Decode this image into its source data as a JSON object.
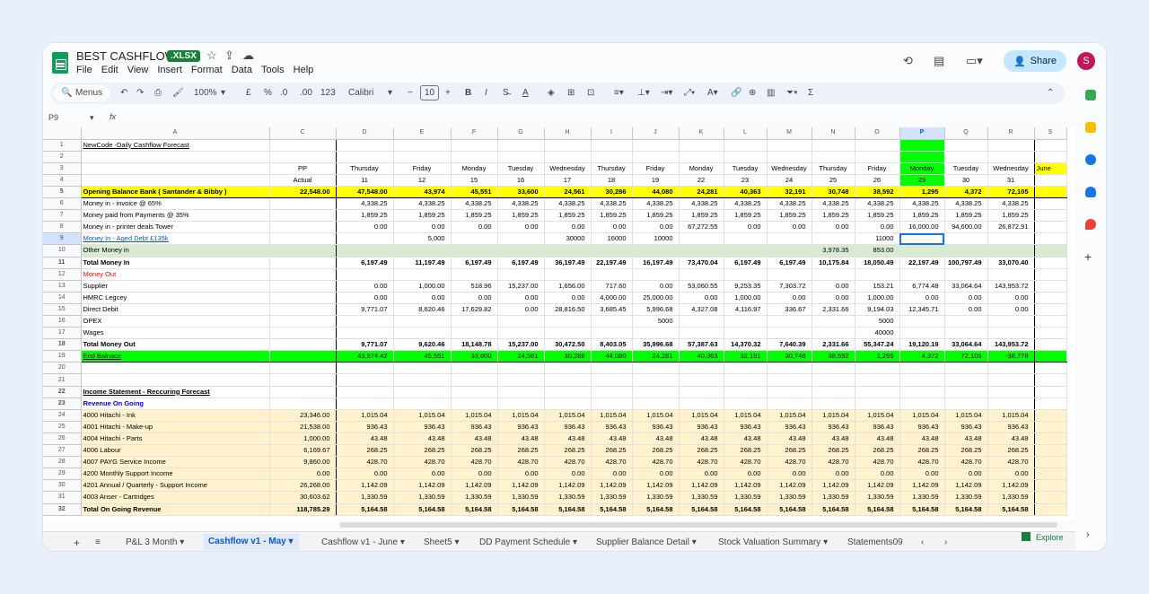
{
  "app": {
    "title": "BEST CASHFLOW",
    "badge": ".XLSX",
    "menus": [
      "File",
      "Edit",
      "View",
      "Insert",
      "Format",
      "Data",
      "Tools",
      "Help"
    ],
    "share": "Share",
    "avatar": "S"
  },
  "toolbar": {
    "menus": "Menus",
    "zoom": "100%",
    "currency": "£",
    "percent": "%",
    "dec_less": ".0",
    "dec_more": ".00",
    "num": "123",
    "font": "Calibri",
    "font_size": "10"
  },
  "formula": {
    "cell": "P9",
    "fx": "fx"
  },
  "columns": [
    "A",
    "C",
    "D",
    "E",
    "F",
    "G",
    "H",
    "I",
    "J",
    "K",
    "L",
    "M",
    "N",
    "O",
    "P",
    "Q",
    "R",
    "S"
  ],
  "rows": [
    {
      "n": "1",
      "cls": "",
      "cells": [
        "NewCode -Daily Cashflow Forecast",
        "",
        "",
        "",
        "",
        "",
        "",
        "",
        "",
        "",
        "",
        "",
        "",
        "",
        "",
        "",
        "",
        ""
      ],
      "u": 1
    },
    {
      "n": "2",
      "cls": "",
      "cells": [
        "",
        "",
        "",
        "",
        "",
        "",
        "",
        "",
        "",
        "",
        "",
        "",
        "",
        "",
        "",
        "",
        "",
        ""
      ]
    },
    {
      "n": "3",
      "cls": "",
      "cells": [
        "",
        "PP",
        "Thursday",
        "Friday",
        "Monday",
        "Tuesday",
        "Wednesday",
        "Thursday",
        "Friday",
        "Monday",
        "Tuesday",
        "Wednesday",
        "Thursday",
        "Friday",
        "Monday",
        "Tuesday",
        "Wednesday",
        "June"
      ],
      "center": 1
    },
    {
      "n": "4",
      "cls": "",
      "cells": [
        "",
        "Actual",
        "11",
        "12",
        "15",
        "16",
        "17",
        "18",
        "19",
        "22",
        "23",
        "24",
        "25",
        "26",
        "29",
        "30",
        "31",
        ""
      ],
      "center": 1
    },
    {
      "n": "5",
      "cls": "ylw bold",
      "cells": [
        "Opening Balance Bank ( Santander & Bibby )",
        "22,548.00",
        "47,548.00",
        "43,974",
        "45,551",
        "33,600",
        "24,561",
        "30,286",
        "44,080",
        "24,281",
        "40,363",
        "32,191",
        "30,748",
        "38,592",
        "1,295",
        "4,372",
        "72,105",
        ""
      ]
    },
    {
      "n": "6",
      "cls": "",
      "cells": [
        "Money in - invoice @ 65%",
        "",
        "4,338.25",
        "4,338.25",
        "4,338.25",
        "4,338.25",
        "4,338.25",
        "4,338.25",
        "4,338.25",
        "4,338.25",
        "4,338.25",
        "4,338.25",
        "4,338.25",
        "4,338.25",
        "4,338.25",
        "4,338.25",
        "4,338.25",
        ""
      ]
    },
    {
      "n": "7",
      "cls": "",
      "cells": [
        "Money paid from Payments @ 35%",
        "",
        "1,859.25",
        "1,859.25",
        "1,859.25",
        "1,859.25",
        "1,859.25",
        "1,859.25",
        "1,859.25",
        "1,859.25",
        "1,859.25",
        "1,859.25",
        "1,859.25",
        "1,859.25",
        "1,859.25",
        "1,859.25",
        "1,859.25",
        ""
      ]
    },
    {
      "n": "8",
      "cls": "",
      "cells": [
        "Money in - printer deals Tower",
        "",
        "0.00",
        "0.00",
        "0.00",
        "0.00",
        "0.00",
        "0.00",
        "0.00",
        "67,272.55",
        "0.00",
        "0.00",
        "0.00",
        "0.00",
        "16,000.00",
        "94,600.00",
        "26,872.91",
        ""
      ]
    },
    {
      "n": "9",
      "cls": "",
      "cells": [
        "Money In - Aged Debt £135k",
        "",
        "",
        "5,000",
        "",
        "",
        "30000",
        "16000",
        "10000",
        "",
        "",
        "",
        "",
        "11000",
        "",
        "",
        "",
        ""
      ],
      "link": 1
    },
    {
      "n": "10",
      "cls": "oth",
      "cells": [
        "Other Money in",
        "",
        "",
        "",
        "",
        "",
        "",
        "",
        "",
        "",
        "",
        "",
        "3,978.35",
        "853.00",
        "",
        "",
        "",
        ""
      ]
    },
    {
      "n": "11",
      "cls": "bold",
      "cells": [
        "Total Money In",
        "",
        "6,197.49",
        "11,197.49",
        "6,197.49",
        "6,197.49",
        "36,197.49",
        "22,197.49",
        "16,197.49",
        "73,470.04",
        "6,197.49",
        "6,197.49",
        "10,175.84",
        "18,050.49",
        "22,197.49",
        "100,797.49",
        "33,070.40",
        ""
      ]
    },
    {
      "n": "12",
      "cls": "",
      "cells": [
        "Money Out",
        "",
        "",
        "",
        "",
        "",
        "",
        "",
        "",
        "",
        "",
        "",
        "",
        "",
        "",
        "",
        "",
        ""
      ],
      "red": 1
    },
    {
      "n": "13",
      "cls": "",
      "cells": [
        "Supplier",
        "",
        "0.00",
        "1,000.00",
        "518.96",
        "15,237.00",
        "1,656.00",
        "717.60",
        "0.00",
        "53,060.55",
        "9,253.35",
        "7,303.72",
        "0.00",
        "153.21",
        "6,774.48",
        "33,064.64",
        "143,953.72",
        ""
      ]
    },
    {
      "n": "14",
      "cls": "",
      "cells": [
        "HMRC Legcey",
        "",
        "0.00",
        "0.00",
        "0.00",
        "0.00",
        "0.00",
        "4,000.00",
        "25,000.00",
        "0.00",
        "1,000.00",
        "0.00",
        "0.00",
        "1,000.00",
        "0.00",
        "0.00",
        "0.00",
        ""
      ]
    },
    {
      "n": "15",
      "cls": "",
      "cells": [
        "Direct Debit",
        "",
        "9,771.07",
        "8,620.46",
        "17,629.82",
        "0.00",
        "28,816.50",
        "3,685.45",
        "5,996.68",
        "4,327.08",
        "4,116.97",
        "336.67",
        "2,331.66",
        "9,194.03",
        "12,345.71",
        "0.00",
        "0.00",
        ""
      ]
    },
    {
      "n": "16",
      "cls": "",
      "cells": [
        "OPEX",
        "",
        "",
        "",
        "",
        "",
        "",
        "",
        "5000",
        "",
        "",
        "",
        "",
        "5000",
        "",
        "",
        "",
        ""
      ]
    },
    {
      "n": "17",
      "cls": "",
      "cells": [
        "Wages",
        "",
        "",
        "",
        "",
        "",
        "",
        "",
        "",
        "",
        "",
        "",
        "",
        "40000",
        "",
        "",
        "",
        ""
      ]
    },
    {
      "n": "18",
      "cls": "bold",
      "cells": [
        "Total Money Out",
        "",
        "9,771.07",
        "9,620.46",
        "18,148.78",
        "15,237.00",
        "30,472.50",
        "8,403.05",
        "35,996.68",
        "57,387.63",
        "14,370.32",
        "7,640.39",
        "2,331.66",
        "55,347.24",
        "19,120.19",
        "33,064.64",
        "143,953.72",
        ""
      ]
    },
    {
      "n": "19",
      "cls": "grn",
      "cells": [
        "End Balnace",
        "",
        "43,974.42",
        "45,551",
        "33,600",
        "24,561",
        "30,286",
        "44,080",
        "24,281",
        "40,363",
        "32,191",
        "30,748",
        "38,592",
        "1,295",
        "4,372",
        "72,105",
        "-38,778",
        ""
      ],
      "u": 1
    },
    {
      "n": "20",
      "cls": "",
      "cells": [
        "",
        "",
        "",
        "",
        "",
        "",
        "",
        "",
        "",
        "",
        "",
        "",
        "",
        "",
        "",
        "",
        "",
        ""
      ]
    },
    {
      "n": "21",
      "cls": "",
      "cells": [
        "",
        "",
        "",
        "",
        "",
        "",
        "",
        "",
        "",
        "",
        "",
        "",
        "",
        "",
        "",
        "",
        "",
        ""
      ]
    },
    {
      "n": "22",
      "cls": "bold",
      "cells": [
        "Income Statement - Reccuring Forecast",
        "",
        "",
        "",
        "",
        "",
        "",
        "",
        "",
        "",
        "",
        "",
        "",
        "",
        "",
        "",
        "",
        ""
      ],
      "u": 1
    },
    {
      "n": "23",
      "cls": "bold",
      "cells": [
        "Revenue On Going",
        "",
        "",
        "",
        "",
        "",
        "",
        "",
        "",
        "",
        "",
        "",
        "",
        "",
        "",
        "",
        "",
        ""
      ],
      "blue": 1
    },
    {
      "n": "24",
      "cls": "tan",
      "cells": [
        "4000 Hitachi - Ink",
        "23,346.00",
        "1,015.04",
        "1,015.04",
        "1,015.04",
        "1,015.04",
        "1,015.04",
        "1,015.04",
        "1,015.04",
        "1,015.04",
        "1,015.04",
        "1,015.04",
        "1,015.04",
        "1,015.04",
        "1,015.04",
        "1,015.04",
        "1,015.04",
        ""
      ]
    },
    {
      "n": "25",
      "cls": "tan",
      "cells": [
        "4001 Hitachi - Make-up",
        "21,538.00",
        "936.43",
        "936.43",
        "936.43",
        "936.43",
        "936.43",
        "936.43",
        "936.43",
        "936.43",
        "936.43",
        "936.43",
        "936.43",
        "936.43",
        "936.43",
        "936.43",
        "936.43",
        ""
      ]
    },
    {
      "n": "26",
      "cls": "tan",
      "cells": [
        "4004 Hitachi - Parts",
        "1,000.00",
        "43.48",
        "43.48",
        "43.48",
        "43.48",
        "43.48",
        "43.48",
        "43.48",
        "43.48",
        "43.48",
        "43.48",
        "43.48",
        "43.48",
        "43.48",
        "43.48",
        "43.48",
        ""
      ]
    },
    {
      "n": "27",
      "cls": "tan",
      "cells": [
        "4006 Labour",
        "6,169.67",
        "268.25",
        "268.25",
        "268.25",
        "268.25",
        "268.25",
        "268.25",
        "268.25",
        "268.25",
        "268.25",
        "268.25",
        "268.25",
        "268.25",
        "268.25",
        "268.25",
        "268.25",
        ""
      ]
    },
    {
      "n": "28",
      "cls": "tan",
      "cells": [
        "4007 PAYG Service Income",
        "9,860.00",
        "428.70",
        "428.70",
        "428.70",
        "428.70",
        "428.70",
        "428.70",
        "428.70",
        "428.70",
        "428.70",
        "428.70",
        "428.70",
        "428.70",
        "428.70",
        "428.70",
        "428.70",
        ""
      ]
    },
    {
      "n": "29",
      "cls": "tan",
      "cells": [
        "4200 Monthly Support Income",
        "0.00",
        "0.00",
        "0.00",
        "0.00",
        "0.00",
        "0.00",
        "0.00",
        "0.00",
        "0.00",
        "0.00",
        "0.00",
        "0.00",
        "0.00",
        "0.00",
        "0.00",
        "0.00",
        ""
      ]
    },
    {
      "n": "30",
      "cls": "tan",
      "cells": [
        "4201 Annual / Quarterly - Support Income",
        "26,268.00",
        "1,142.09",
        "1,142.09",
        "1,142.09",
        "1,142.09",
        "1,142.09",
        "1,142.09",
        "1,142.09",
        "1,142.09",
        "1,142.09",
        "1,142.09",
        "1,142.09",
        "1,142.09",
        "1,142.09",
        "1,142.09",
        "1,142.09",
        ""
      ]
    },
    {
      "n": "31",
      "cls": "tan",
      "cells": [
        "4003 Anser - Cartridges",
        "30,603.62",
        "1,330.59",
        "1,330.59",
        "1,330.59",
        "1,330.59",
        "1,330.59",
        "1,330.59",
        "1,330.59",
        "1,330.59",
        "1,330.59",
        "1,330.59",
        "1,330.59",
        "1,330.59",
        "1,330.59",
        "1,330.59",
        "1,330.59",
        ""
      ]
    },
    {
      "n": "32",
      "cls": "tan bold",
      "cells": [
        "Total  On Going Revenue",
        "118,785.29",
        "5,164.58",
        "5,164.58",
        "5,164.58",
        "5,164.58",
        "5,164.58",
        "5,164.58",
        "5,164.58",
        "5,164.58",
        "5,164.58",
        "5,164.58",
        "5,164.58",
        "5,164.58",
        "5,164.58",
        "5,164.58",
        "5,164.58",
        ""
      ]
    }
  ],
  "tabs": [
    "P&L 3 Month",
    "Cashflow v1 - May",
    "Cashflow v1 - June",
    "Sheet5",
    "DD Payment Schedule",
    "Supplier Balance Detail",
    "Stock Valuation Summary",
    "Statements09"
  ],
  "active_tab": "Cashflow v1 - May",
  "explore": "Explore",
  "colors": {
    "sheets_green": "#0f9d58",
    "yellow": "#ffff00",
    "green": "#00ff00",
    "tan": "#fff2cc",
    "other": "#d9ead3"
  }
}
